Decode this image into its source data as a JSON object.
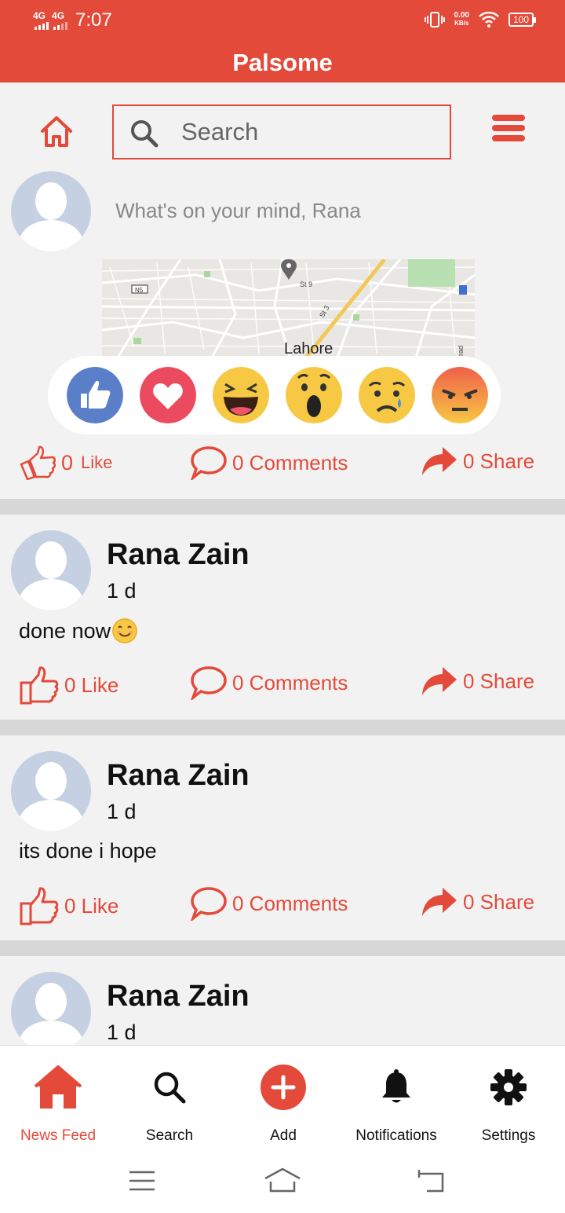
{
  "status_bar": {
    "network_1": "4G",
    "network_2": "4G",
    "time": "7:07",
    "speed_value": "0.00",
    "speed_unit": "KB/s",
    "battery": "100"
  },
  "app": {
    "title": "Palsome"
  },
  "top_nav": {
    "search_placeholder": "Search"
  },
  "composer": {
    "prompt": "What's on your mind, Rana",
    "map_city": "Lahore",
    "map_labels": [
      "N5",
      "St 9",
      "St 3",
      "ead"
    ],
    "reactions": [
      "like-icon",
      "love-icon",
      "haha-icon",
      "wow-icon",
      "sad-icon",
      "angry-icon"
    ],
    "like": {
      "count": "0",
      "label": "Like"
    },
    "comments": "0 Comments",
    "share": "0 Share"
  },
  "posts": [
    {
      "author": "Rana Zain",
      "time": "1 d",
      "text": "done now",
      "emoji": "smiling-face-icon",
      "like": "0 Like",
      "comments": "0 Comments",
      "share": "0 Share"
    },
    {
      "author": "Rana Zain",
      "time": "1 d",
      "text": "its done i hope",
      "like": "0 Like",
      "comments": "0 Comments",
      "share": "0 Share"
    },
    {
      "author": "Rana Zain",
      "time": "1 d"
    }
  ],
  "bottom_nav": {
    "tabs": [
      {
        "label": "News Feed",
        "icon": "home-icon"
      },
      {
        "label": "Search",
        "icon": "search-icon"
      },
      {
        "label": "Add",
        "icon": "add-icon"
      },
      {
        "label": "Notifications",
        "icon": "bell-icon"
      },
      {
        "label": "Settings",
        "icon": "gear-icon"
      }
    ]
  },
  "colors": {
    "accent": "#e34a3a",
    "background": "#f2f2f2",
    "divider": "#d7d7d7"
  }
}
